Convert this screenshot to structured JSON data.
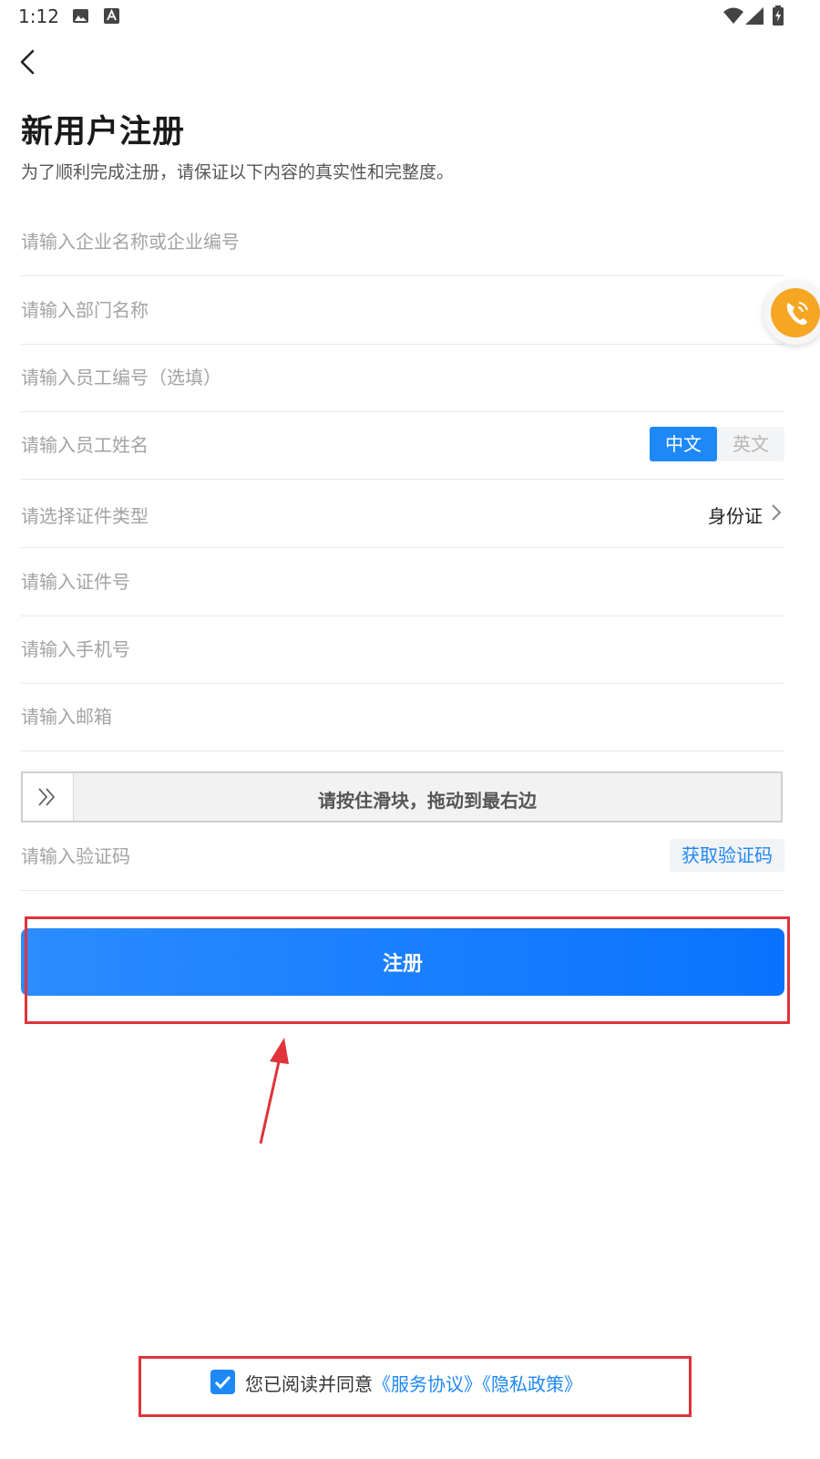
{
  "status_bar": {
    "time": "1:12"
  },
  "header": {
    "title": "新用户注册",
    "subtitle": "为了顺利完成注册，请保证以下内容的真实性和完整度。"
  },
  "form": {
    "company_placeholder": "请输入企业名称或企业编号",
    "department_placeholder": "请输入部门名称",
    "employee_id_placeholder": "请输入员工编号（选填）",
    "employee_name_placeholder": "请输入员工姓名",
    "lang_cn": "中文",
    "lang_en": "英文",
    "id_type_label": "请选择证件类型",
    "id_type_value": "身份证",
    "id_number_placeholder": "请输入证件号",
    "phone_placeholder": "请输入手机号",
    "email_placeholder": "请输入邮箱",
    "slider_text": "请按住滑块，拖动到最右边",
    "code_placeholder": "请输入验证码",
    "get_code_label": "获取验证码"
  },
  "register_button": "注册",
  "agreement": {
    "checked": true,
    "prefix": "您已阅读并同意",
    "service_link": "《服务协议》",
    "privacy_link": "《隐私政策》"
  },
  "colors": {
    "accent": "#1e88f7",
    "highlight": "#e0333b",
    "call_button": "#f5a623"
  }
}
